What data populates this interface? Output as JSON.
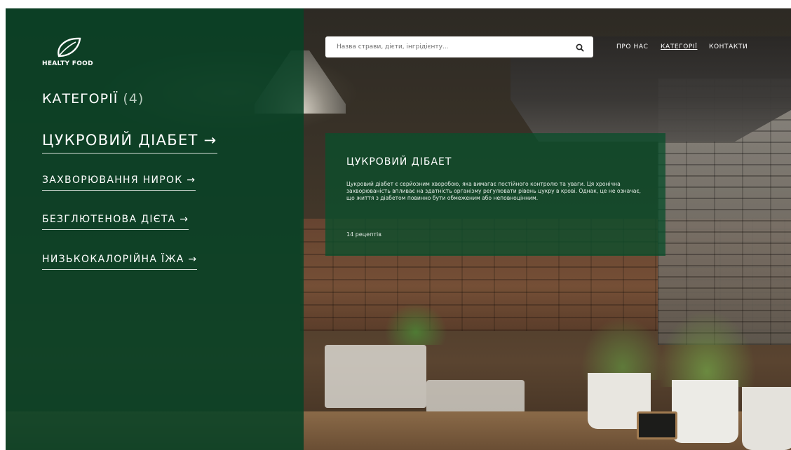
{
  "brand": {
    "name": "HEALTY FOOD",
    "logo_icon": "leaf-icon"
  },
  "search": {
    "placeholder": "Назва страви, дієти, інгрідієнту...",
    "value": "",
    "icon": "search-icon"
  },
  "nav": {
    "items": [
      {
        "label": "ПРО НАС"
      },
      {
        "label": "КАТЕГОРІЇ",
        "active": true
      },
      {
        "label": "КОНТАКТИ"
      }
    ]
  },
  "sidebar": {
    "heading": "КАТЕГОРІЇ",
    "count": "(4)",
    "categories": [
      {
        "label": "ЦУКРОВИЙ ДІАБЕТ →",
        "active": true
      },
      {
        "label": "ЗАХВОРЮВАННЯ НИРОК →"
      },
      {
        "label": "БЕЗГЛЮТЕНОВА ДІЄТА →"
      },
      {
        "label": "НИЗЬКОКАЛОРІЙНА ЇЖА →"
      }
    ]
  },
  "info_card": {
    "title": "ЦУКРОВИЙ ДІБАЕТ",
    "description": "Цукровий діабет є серйозним хворобою, яка вимагає постійного контролю та уваги. Ця хронічна захворюваність впливає на здатність організму регулювати рівень цукру в крові. Однак, це не означає, що життя з діабетом повинно бути обмеженим або неповноцінним.",
    "recipes": "14 рецептів"
  },
  "colors": {
    "overlay_green": "#084226",
    "card_green": "#0a4e2c",
    "text_white": "#ffffff"
  }
}
